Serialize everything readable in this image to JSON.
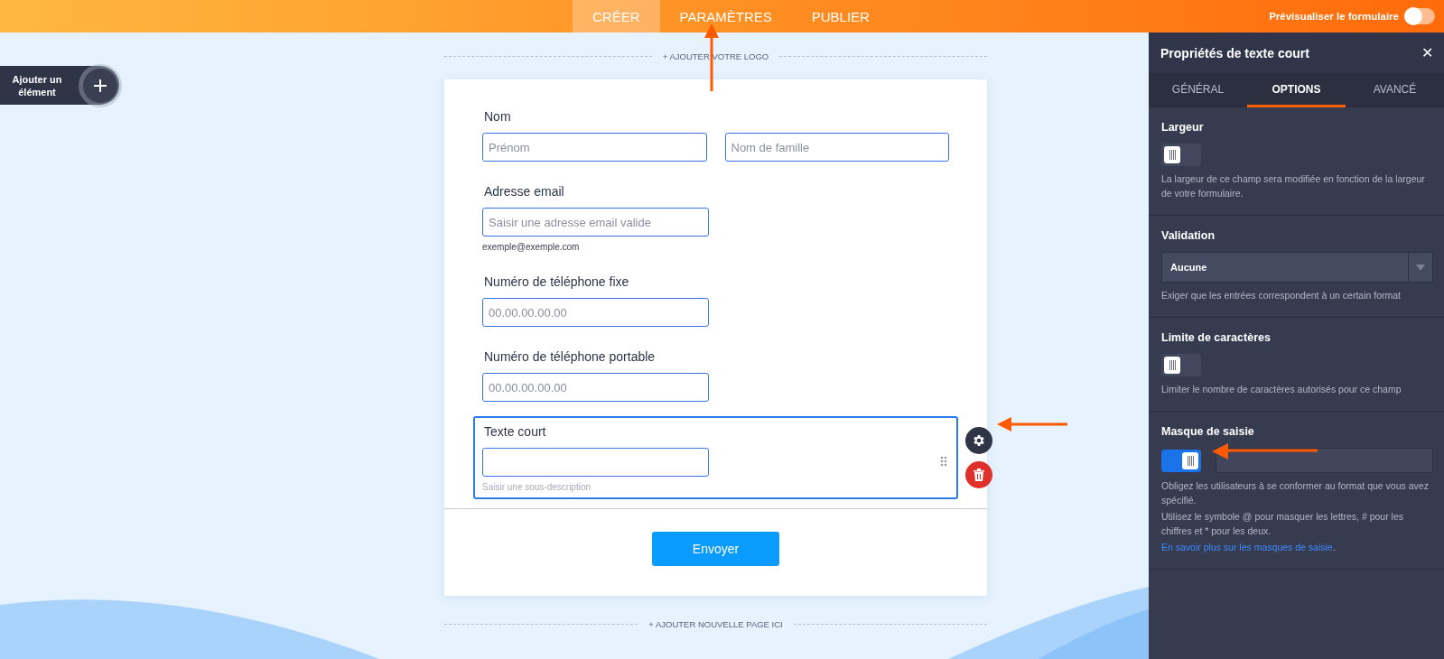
{
  "top_nav": {
    "tabs": [
      {
        "label": "CRÉER",
        "selected": true
      },
      {
        "label": "PARAMÈTRES",
        "selected": false
      },
      {
        "label": "PUBLIER",
        "selected": false
      }
    ],
    "preview": {
      "label": "Prévisualiser le formulaire",
      "on": false
    }
  },
  "add_element_button": {
    "label": "Ajouter un élément"
  },
  "add_logo": "+ AJOUTER VOTRE LOGO",
  "form": {
    "fields": [
      {
        "kind": "name",
        "label": "Nom",
        "placeholders": [
          "Prénom",
          "Nom de famille"
        ],
        "selected": false
      },
      {
        "kind": "text",
        "label": "Adresse email",
        "placeholder": "Saisir une adresse email valide",
        "sublabel": "exemple@exemple.com",
        "selected": false
      },
      {
        "kind": "text",
        "label": "Numéro de téléphone fixe",
        "placeholder": "00.00.00.00.00",
        "selected": false
      },
      {
        "kind": "text",
        "label": "Numéro de téléphone portable",
        "placeholder": "00.00.00.00.00",
        "selected": false
      },
      {
        "kind": "text",
        "label": "Texte court",
        "sublabel": "Saisir une sous-description",
        "selected": true
      }
    ],
    "submit": "Envoyer"
  },
  "add_page": "+ AJOUTER NOUVELLE PAGE ICI",
  "panel": {
    "title": "Propriétés de texte court",
    "close": "✕",
    "tabs": [
      {
        "label": "GÉNÉRAL",
        "selected": false
      },
      {
        "label": "OPTIONS",
        "selected": true
      },
      {
        "label": "AVANCÉ",
        "selected": false
      }
    ],
    "sections": [
      {
        "kind": "toggle",
        "title": "Largeur",
        "on": false,
        "description": [
          "La largeur de ce champ sera modifiée en fonction de la largeur de votre formulaire."
        ]
      },
      {
        "kind": "select",
        "title": "Validation",
        "value": "Aucune",
        "description": [
          "Exiger que les entrées correspondent à un certain format"
        ]
      },
      {
        "kind": "toggle",
        "title": "Limite de caractères",
        "on": false,
        "description": [
          "Limiter le nombre de caractères autorisés pour ce champ"
        ]
      },
      {
        "kind": "toggle_input",
        "title": "Masque de saisie",
        "on": true,
        "description": [
          "Obligez les utilisateurs à se conformer au format que vous avez spécifié.",
          "Utilisez le symbole @ pour masquer les lettres, # pour les chiffres et * pour les deux."
        ],
        "link": "En savoir plus sur les masques de saisie",
        "link_suffix": "."
      }
    ]
  }
}
